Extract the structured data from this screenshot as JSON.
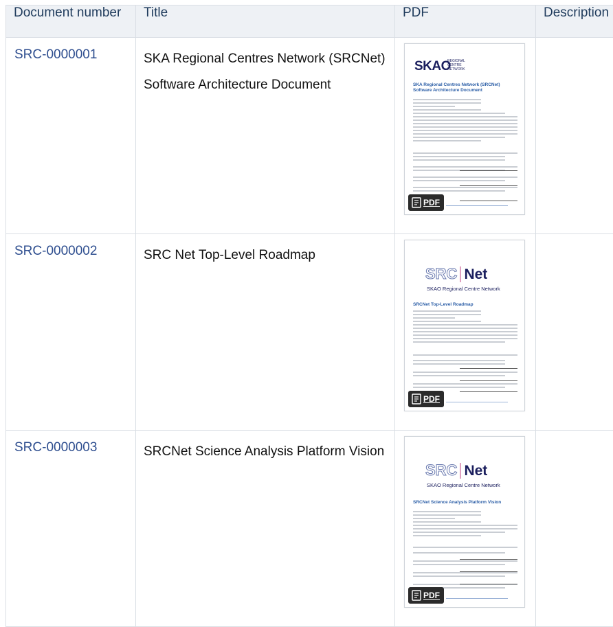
{
  "table": {
    "headers": [
      "Document number",
      "Title",
      "PDF",
      "Description"
    ],
    "rows": [
      {
        "number": "SRC-0000001",
        "title": "SKA Regional Centres Network (SRCNet) Software Architecture Document",
        "thumb_logo": "SKAO",
        "thumb_logo_sub": "REGIONAL CENTRE NETWORK",
        "thumb_title": "SKA Regional Centres Network (SRCNet) Software Architecture Document",
        "pdf_badge": "PDF"
      },
      {
        "number": "SRC-0000002",
        "title": "SRC Net Top-Level Roadmap",
        "thumb_logo_left": "SRC",
        "thumb_logo_right": "Net",
        "thumb_logo_sub": "SKAO Regional Centre Network",
        "thumb_title": "SRCNet Top-Level Roadmap",
        "pdf_badge": "PDF"
      },
      {
        "number": "SRC-0000003",
        "title": "SRCNet Science Analysis Platform Vision",
        "thumb_logo_left": "SRC",
        "thumb_logo_right": "Net",
        "thumb_logo_sub": "SKAO Regional Centre Network",
        "thumb_title": "SRCNet Science Analysis Platform Vision",
        "pdf_badge": "PDF"
      }
    ]
  },
  "colors": {
    "header_bg": "#eef1f5",
    "link": "#2e4e8f",
    "border": "#d9dee4",
    "badge_bg": "#2b2b2b"
  }
}
